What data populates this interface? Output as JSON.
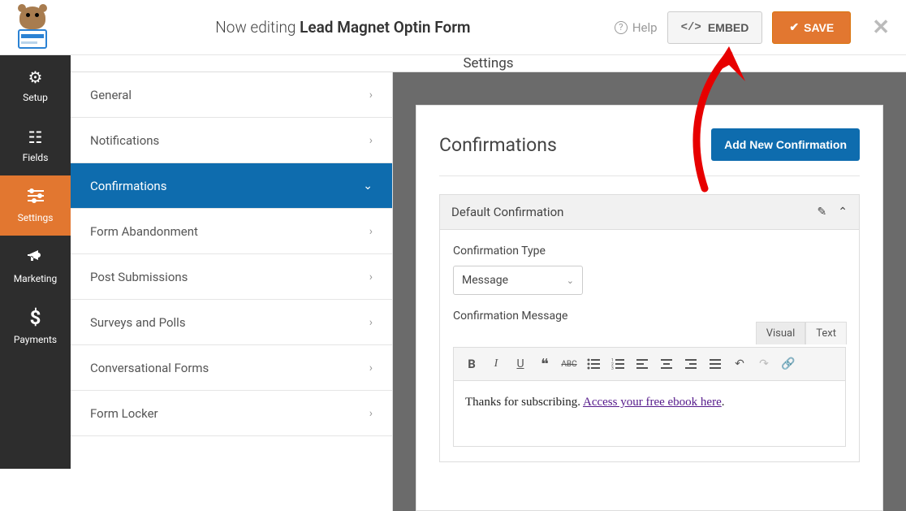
{
  "header": {
    "editing_prefix": "Now editing",
    "form_name": "Lead Magnet Optin Form",
    "help_label": "Help",
    "embed_label": "EMBED",
    "save_label": "SAVE"
  },
  "side_nav": [
    {
      "id": "setup",
      "label": "Setup",
      "icon": "gear"
    },
    {
      "id": "fields",
      "label": "Fields",
      "icon": "list"
    },
    {
      "id": "settings",
      "label": "Settings",
      "icon": "sliders",
      "active": true
    },
    {
      "id": "marketing",
      "label": "Marketing",
      "icon": "megaphone"
    },
    {
      "id": "payments",
      "label": "Payments",
      "icon": "dollar"
    }
  ],
  "settings_panel": {
    "title": "Settings",
    "menu": [
      {
        "label": "General"
      },
      {
        "label": "Notifications"
      },
      {
        "label": "Confirmations",
        "active": true
      },
      {
        "label": "Form Abandonment"
      },
      {
        "label": "Post Submissions"
      },
      {
        "label": "Surveys and Polls"
      },
      {
        "label": "Conversational Forms"
      },
      {
        "label": "Form Locker"
      }
    ]
  },
  "confirmations": {
    "title": "Confirmations",
    "add_button": "Add New Confirmation",
    "item_title": "Default Confirmation",
    "type_label": "Confirmation Type",
    "type_value": "Message",
    "message_label": "Confirmation Message",
    "editor_tabs": {
      "visual": "Visual",
      "text": "Text"
    },
    "message_text": "Thanks for subscribing. ",
    "message_link": "Access your free ebook here",
    "message_suffix": "."
  }
}
